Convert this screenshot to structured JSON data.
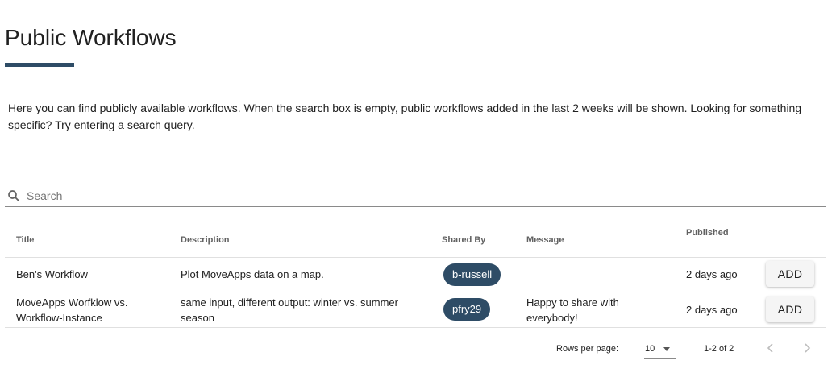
{
  "page": {
    "title": "Public Workflows",
    "intro": "Here you can find publicly available workflows. When the search box is empty, public workflows added in the last 2 weeks will be shown. Looking for something specific? Try entering a search query."
  },
  "search": {
    "placeholder": "Search",
    "value": ""
  },
  "table": {
    "headers": {
      "title": "Title",
      "description": "Description",
      "shared_by": "Shared By",
      "message": "Message",
      "published": "Published"
    },
    "rows": [
      {
        "title": "Ben's Workflow",
        "description": "Plot MoveApps data on a map.",
        "shared_by": "b-russell",
        "message": "",
        "published": "2 days ago",
        "action": "ADD"
      },
      {
        "title": "MoveApps Worfklow vs. Workflow-Instance",
        "description": "same input, different output: winter vs. summer season",
        "shared_by": "pfry29",
        "message": "Happy to share with everybody!",
        "published": "2 days ago",
        "action": "ADD"
      }
    ]
  },
  "pagination": {
    "rows_per_page_label": "Rows per page:",
    "rows_per_page_value": "10",
    "range": "1-2 of 2"
  },
  "colors": {
    "accent": "#2e4c66"
  },
  "icons": {
    "search": "search-icon",
    "prev": "chevron-left-icon",
    "next": "chevron-right-icon",
    "dropdown": "caret-down-icon"
  }
}
